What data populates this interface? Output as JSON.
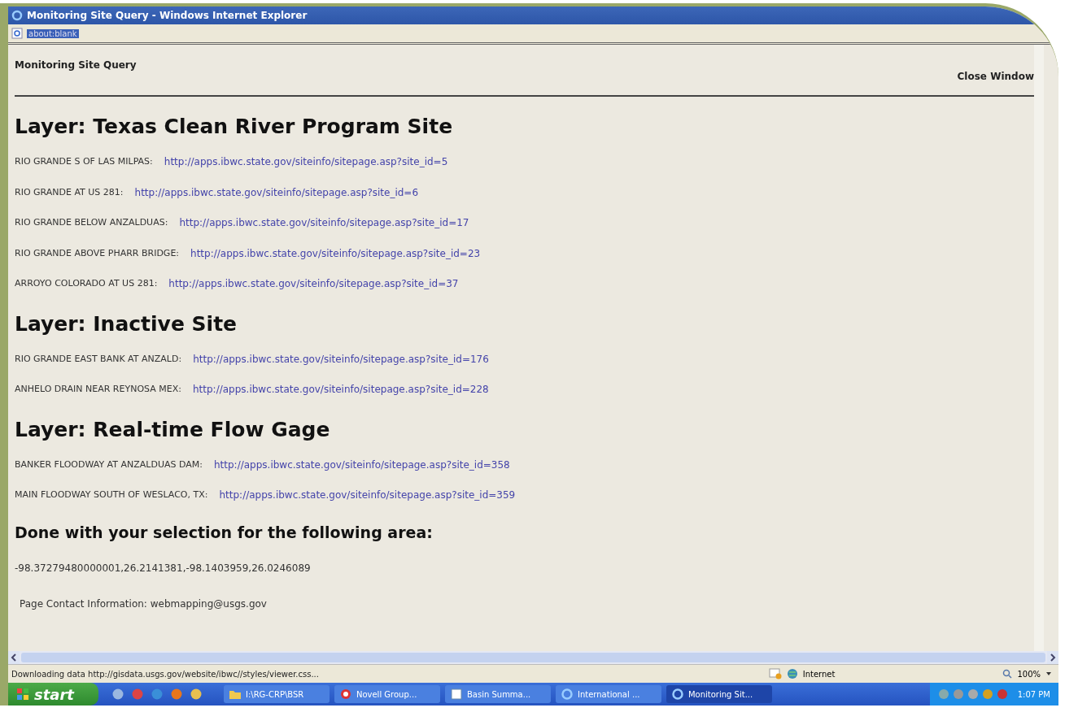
{
  "window": {
    "title": "Monitoring Site Query - Windows Internet Explorer"
  },
  "address_bar": {
    "value": "about:blank"
  },
  "page": {
    "title": "Monitoring Site Query",
    "close_link": "Close Window",
    "layers": [
      {
        "heading": "Layer: Texas Clean River Program Site",
        "sites": [
          {
            "name": "RIO GRANDE S OF LAS MILPAS:",
            "url": "http://apps.ibwc.state.gov/siteinfo/sitepage.asp?site_id=5"
          },
          {
            "name": "RIO GRANDE AT US 281:",
            "url": "http://apps.ibwc.state.gov/siteinfo/sitepage.asp?site_id=6"
          },
          {
            "name": "RIO GRANDE BELOW ANZALDUAS:",
            "url": "http://apps.ibwc.state.gov/siteinfo/sitepage.asp?site_id=17"
          },
          {
            "name": "RIO GRANDE ABOVE PHARR BRIDGE:",
            "url": "http://apps.ibwc.state.gov/siteinfo/sitepage.asp?site_id=23"
          },
          {
            "name": "ARROYO COLORADO AT US 281:",
            "url": "http://apps.ibwc.state.gov/siteinfo/sitepage.asp?site_id=37"
          }
        ]
      },
      {
        "heading": "Layer: Inactive Site",
        "sites": [
          {
            "name": "RIO GRANDE EAST BANK AT ANZALD:",
            "url": "http://apps.ibwc.state.gov/siteinfo/sitepage.asp?site_id=176"
          },
          {
            "name": "ANHELO DRAIN NEAR REYNOSA MEX:",
            "url": "http://apps.ibwc.state.gov/siteinfo/sitepage.asp?site_id=228"
          }
        ]
      },
      {
        "heading": "Layer: Real-time Flow Gage",
        "sites": [
          {
            "name": "BANKER FLOODWAY AT ANZALDUAS DAM:",
            "url": "http://apps.ibwc.state.gov/siteinfo/sitepage.asp?site_id=358"
          },
          {
            "name": "MAIN FLOODWAY SOUTH OF WESLACO, TX:",
            "url": "http://apps.ibwc.state.gov/siteinfo/sitepage.asp?site_id=359"
          }
        ]
      }
    ],
    "done_heading": "Done with your selection for the following area:",
    "area": "-98.37279480000001,26.2141381,-98.1403959,26.0246089",
    "contact": "Page Contact Information: webmapping@usgs.gov"
  },
  "status_bar": {
    "text": "Downloading data http://gisdata.usgs.gov/website/ibwc//styles/viewer.css...",
    "zone": "Internet",
    "zoom": "100%"
  },
  "taskbar": {
    "start": "start",
    "tasks": [
      {
        "label": "I:\\RG-CRP\\BSR",
        "kind": "folder",
        "selected": false
      },
      {
        "label": "Novell Group...",
        "kind": "mail",
        "selected": false
      },
      {
        "label": "Basin Summa...",
        "kind": "document",
        "selected": false
      },
      {
        "label": "International ...",
        "kind": "browser",
        "selected": false
      },
      {
        "label": "Monitoring Sit...",
        "kind": "browser",
        "selected": true
      }
    ],
    "clock": "1:07 PM"
  }
}
